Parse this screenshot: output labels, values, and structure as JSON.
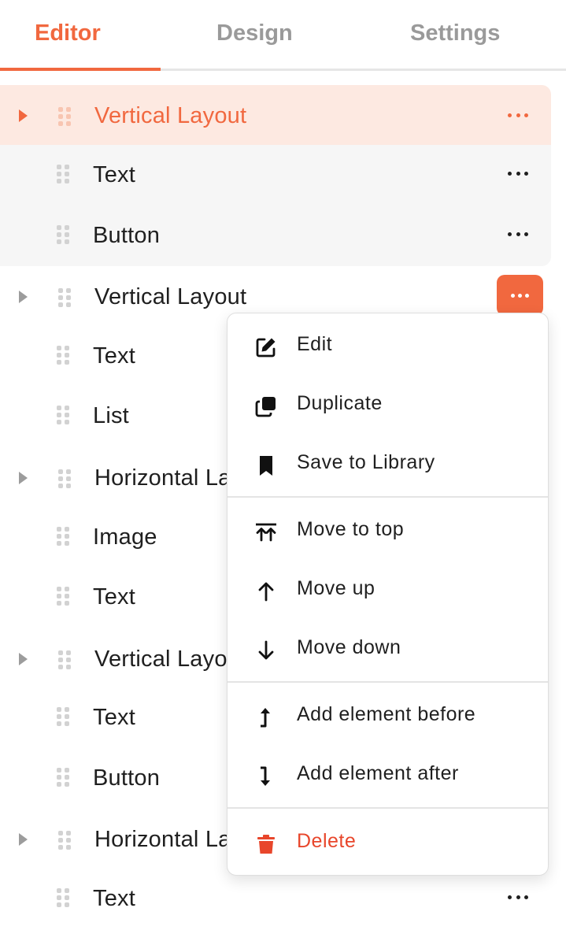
{
  "tabs": [
    {
      "label": "Editor",
      "active": true
    },
    {
      "label": "Design",
      "active": false
    },
    {
      "label": "Settings",
      "active": false
    }
  ],
  "tree": [
    {
      "label": "Vertical Layout",
      "type": "container",
      "state": "selected"
    },
    {
      "label": "Text",
      "type": "leaf"
    },
    {
      "label": "Button",
      "type": "leaf"
    },
    {
      "label": "Vertical Layout",
      "type": "container",
      "state": "menu-open"
    },
    {
      "label": "Text",
      "type": "leaf"
    },
    {
      "label": "List",
      "type": "leaf"
    },
    {
      "label": "Horizontal Layout",
      "type": "container"
    },
    {
      "label": "Image",
      "type": "leaf"
    },
    {
      "label": "Text",
      "type": "leaf"
    },
    {
      "label": "Vertical Layout",
      "type": "container"
    },
    {
      "label": "Text",
      "type": "leaf"
    },
    {
      "label": "Button",
      "type": "leaf"
    },
    {
      "label": "Horizontal Layout",
      "type": "container"
    },
    {
      "label": "Text",
      "type": "leaf"
    }
  ],
  "context_menu": {
    "items": [
      {
        "label": "Edit",
        "icon": "pencil-square-icon"
      },
      {
        "label": "Duplicate",
        "icon": "copy-icon"
      },
      {
        "label": "Save to Library",
        "icon": "bookmark-icon"
      },
      {
        "label": "Move to top",
        "icon": "double-arrow-up-icon"
      },
      {
        "label": "Move up",
        "icon": "arrow-up-icon"
      },
      {
        "label": "Move down",
        "icon": "arrow-down-icon"
      },
      {
        "label": "Add element before",
        "icon": "turn-up-arrow-icon"
      },
      {
        "label": "Add element after",
        "icon": "turn-down-arrow-icon"
      },
      {
        "label": "Delete",
        "icon": "trash-icon",
        "danger": true
      }
    ]
  },
  "colors": {
    "accent": "#f1683f",
    "accent_soft": "#fde9e1",
    "group_bg": "#f6f6f6",
    "danger": "#e8462b",
    "muted": "#9a9a9a"
  }
}
